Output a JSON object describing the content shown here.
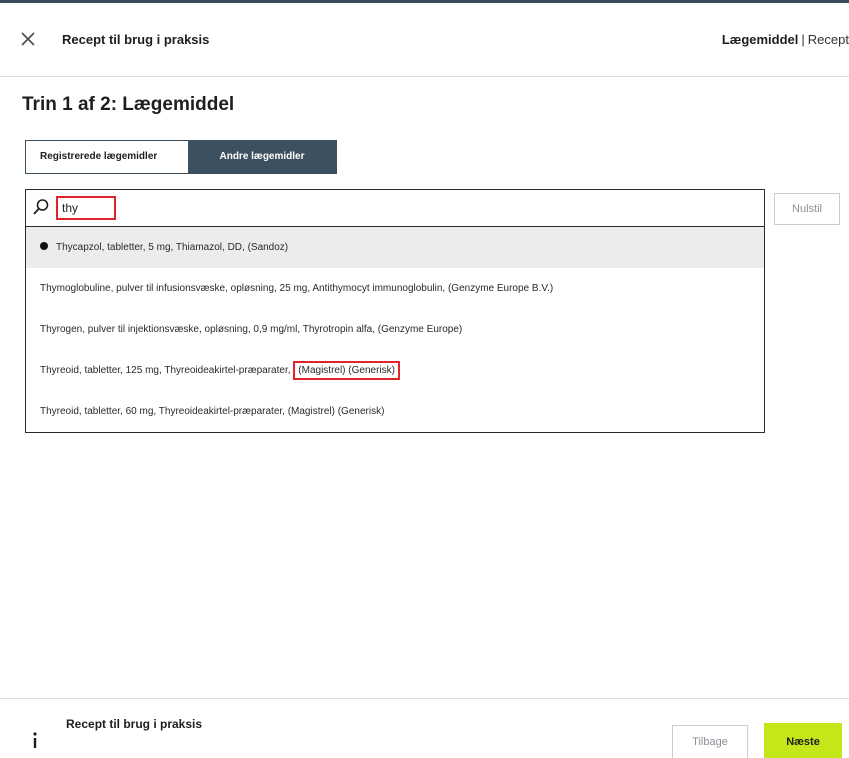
{
  "header": {
    "title": "Recept til brug i praksis",
    "crumb_active": "Lægemiddel",
    "crumb_separator": "|",
    "crumb_next": "Recept"
  },
  "step": {
    "title": "Trin 1 af 2: Lægemiddel"
  },
  "tabs": [
    {
      "label": "Registrerede lægemidler",
      "active": true
    },
    {
      "label": "Andre lægemidler",
      "active": false
    }
  ],
  "search": {
    "value": "thy",
    "reset_label": "Nulstil"
  },
  "results": [
    {
      "text": "Thycapzol, tabletter, 5 mg, Thiamazol, DD, (Sandoz)",
      "selected": true
    },
    {
      "text": "Thymoglobuline, pulver til infusionsvæske, opløsning, 25 mg, Antithymocyt immunoglobulin, (Genzyme Europe B.V.)",
      "selected": false
    },
    {
      "text": "Thyrogen, pulver til injektionsvæske, opløsning, 0,9 mg/ml, Thyrotropin alfa, (Genzyme Europe)",
      "selected": false
    },
    {
      "text_before": "Thyreoid, tabletter, 125 mg, Thyreoideakirtel-præparater,",
      "text_highlight": "(Magistrel) (Generisk)",
      "selected": false
    },
    {
      "text": "Thyreoid, tabletter, 60 mg, Thyreoideakirtel-præparater, (Magistrel) (Generisk)",
      "selected": false
    }
  ],
  "footer": {
    "title": "Recept til brug i praksis",
    "back_label": "Tilbage",
    "next_label": "Næste"
  },
  "colors": {
    "accent_green": "#c4e71a",
    "tab_dark": "#3d5060",
    "highlight_red": "#e0242a"
  },
  "icons": {
    "close": "close-icon",
    "search": "search-icon",
    "info": "info-icon"
  }
}
